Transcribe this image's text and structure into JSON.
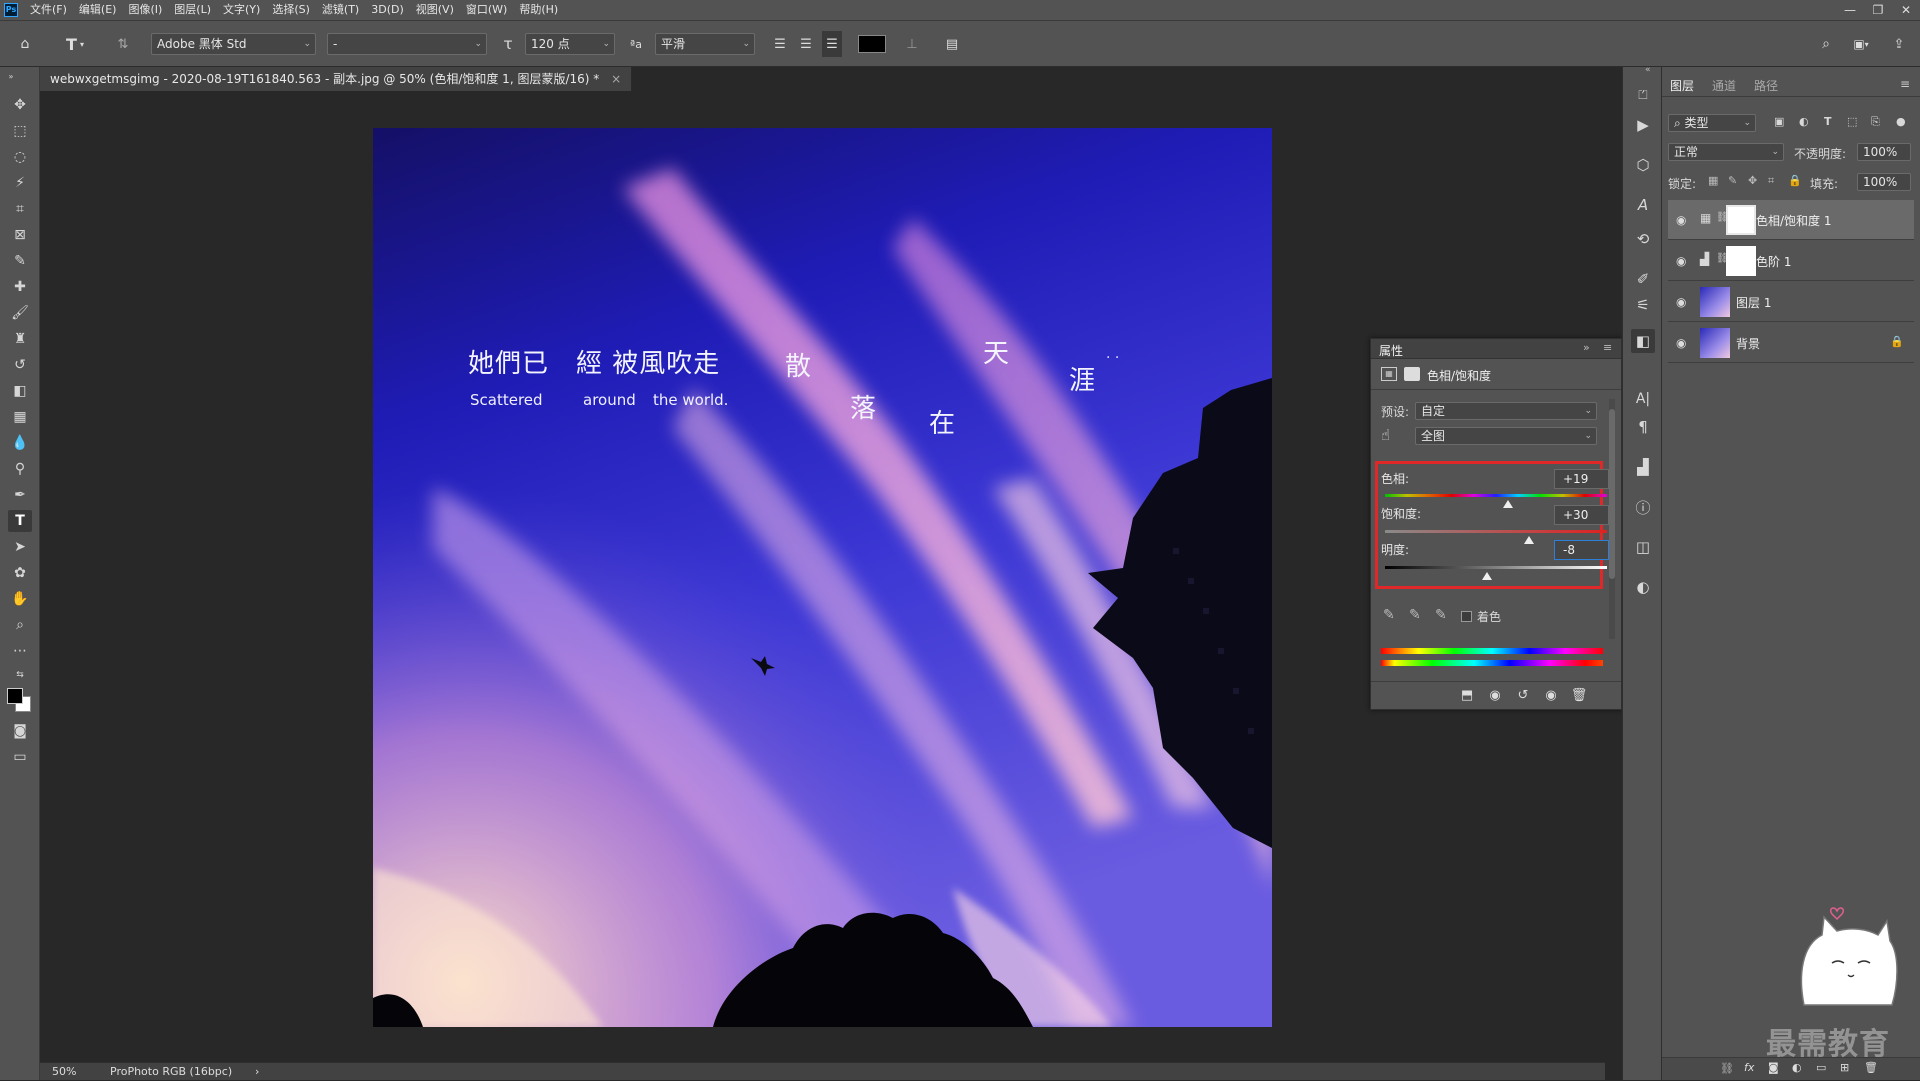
{
  "app": {
    "logo": "Ps"
  },
  "menu": [
    "文件(F)",
    "编辑(E)",
    "图像(I)",
    "图层(L)",
    "文字(Y)",
    "选择(S)",
    "滤镜(T)",
    "3D(D)",
    "视图(V)",
    "窗口(W)",
    "帮助(H)"
  ],
  "window_controls": {
    "minimize": "—",
    "restore": "❐",
    "close": "✕"
  },
  "options": {
    "font_family": "Adobe 黑体 Std",
    "font_style": "-",
    "font_size": "120 点",
    "aa_label": "ªa",
    "antialias": "平滑",
    "text_color": "#000000"
  },
  "document": {
    "tab_title": "webwxgetmsgimg - 2020-08-19T161840.563 - 副本.jpg @ 50% (色相/饱和度 1, 图层蒙版/16) *",
    "tab_close": "×"
  },
  "photo": {
    "cn_line": "她們已　經 被風吹走",
    "en_1": "Scattered",
    "en_2": "around",
    "en_3": "the world.",
    "char_1": "散",
    "char_2": "落",
    "char_3": "在",
    "char_4": "天",
    "char_5": "涯",
    "dots": ". ."
  },
  "status": {
    "zoom": "50%",
    "profile": "ProPhoto RGB (16bpc)",
    "arrow": "›"
  },
  "properties": {
    "title": "属性",
    "adjustment_name": "色相/饱和度",
    "preset_label": "预设:",
    "preset_value": "自定",
    "channel_value": "全图",
    "hue_label": "色相:",
    "hue_value": "+19",
    "hue_amount": 19,
    "saturation_label": "饱和度:",
    "saturation_value": "+30",
    "saturation_amount": 30,
    "lightness_label": "明度:",
    "lightness_value": "-8",
    "lightness_amount": -8,
    "colorize_label": "着色",
    "colorize_checked": false
  },
  "layers_panel": {
    "tabs": [
      "图层",
      "通道",
      "路径"
    ],
    "filter_value": "类型",
    "blend_mode": "正常",
    "opacity_label": "不透明度:",
    "opacity_value": "100%",
    "lock_label": "锁定:",
    "fill_label": "填充:",
    "fill_value": "100%",
    "layers": [
      {
        "name": "色相/饱和度 1",
        "selected": true
      },
      {
        "name": "色阶 1",
        "selected": false
      },
      {
        "name": "图层 1",
        "selected": false
      },
      {
        "name": "背景",
        "selected": false
      }
    ]
  },
  "watermark": {
    "text": "最需教育"
  },
  "colors": {
    "accent_red": "#e02828",
    "panel": "#535353",
    "canvas_bg": "#282828"
  }
}
